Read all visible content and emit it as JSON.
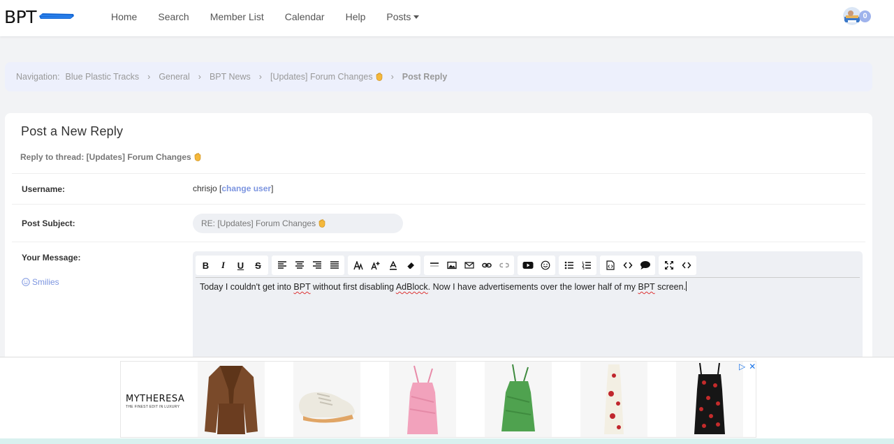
{
  "header": {
    "logo": "BPT",
    "nav": [
      "Home",
      "Search",
      "Member List",
      "Calendar",
      "Help",
      "Posts"
    ],
    "notifications_count": "0"
  },
  "breadcrumb": {
    "label": "Navigation:",
    "items": [
      "Blue Plastic Tracks",
      "General",
      "BPT News",
      "[Updates] Forum Changes"
    ],
    "current": "Post Reply",
    "separator": "›"
  },
  "form": {
    "title": "Post a New Reply",
    "subtitle": "Reply to thread: [Updates] Forum Changes",
    "username_label": "Username:",
    "username_value": "chrisjo",
    "change_user_open": "[",
    "change_user": "change user",
    "change_user_close": "]",
    "subject_label": "Post Subject:",
    "subject_value": "RE: [Updates] Forum Changes",
    "message_label": "Your Message:",
    "smilies": "Smilies"
  },
  "editor": {
    "toolbar": [
      "bold",
      "italic",
      "underline",
      "strikethrough",
      "align-left",
      "align-center",
      "align-right",
      "justify",
      "font",
      "font-size",
      "font-color",
      "remove-format",
      "horizontal-rule",
      "image",
      "email",
      "link",
      "unlink",
      "youtube",
      "emoticon",
      "bullet-list",
      "ordered-list",
      "source-code",
      "code",
      "quote",
      "maximize",
      "source"
    ],
    "text_parts": [
      "Today I couldn't get into ",
      "BPT",
      " without first disabling ",
      "AdBlock",
      ". Now I have advertisements over the lower half of my ",
      "BPT",
      " screen."
    ]
  },
  "ad": {
    "brand": "MYTHERESA",
    "tagline": "THE FINEST EDIT IN LUXURY",
    "adchoices": "▷",
    "close": "✕"
  },
  "colors": {
    "accent": "#7c95e0",
    "breadcrumb_bg": "#edf0fc",
    "editor_bg": "#eef0f4",
    "badge": "#9fb3ec"
  }
}
